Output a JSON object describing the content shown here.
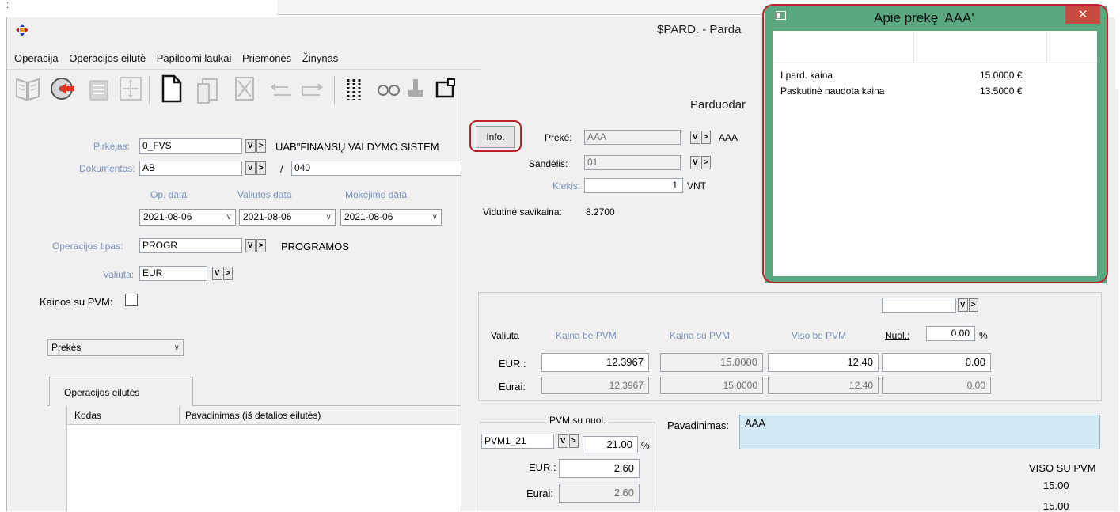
{
  "app": {
    "title": "$PARD. - Parda",
    "menu": [
      "Operacija",
      "Operacijos eilutė",
      "Papildomi laukai",
      "Priemonės",
      "Žinynas"
    ]
  },
  "form": {
    "pirkejas_label": "Pirkėjas:",
    "pirkejas_value": "0_FVS",
    "pirkejas_name": "UAB\"FINANSŲ VALDYMO SISTEM",
    "dokumentas_label": "Dokumentas:",
    "dokumentas_value": "AB",
    "dokumentas_sep": "/",
    "dokumentas_number": "040",
    "op_data_label": "Op. data",
    "valiutos_data_label": "Valiutos data",
    "mokejimo_data_label": "Mokėjimo data",
    "op_data": "2021-08-06",
    "valiutos_data": "2021-08-06",
    "mokejimo_data": "2021-08-06",
    "operacijos_tipas_label": "Operacijos tipas:",
    "operacijos_tipas_value": "PROGR",
    "operacijos_tipas_name": "PROGRAMOS",
    "valiuta_label": "Valiuta:",
    "valiuta_value": "EUR",
    "kainos_su_pvm_label": "Kainos su PVM:",
    "prekes_select": "Prekės",
    "tab_label": "Operacijos eilutės",
    "col_kodas": "Kodas",
    "col_pavadinimas": "Pavadinimas (iš detalios eilutės)"
  },
  "line_dialog": {
    "title": "Parduodar",
    "info_button": "Info.",
    "preke_label": "Prekė:",
    "preke_value": "AAA",
    "preke_name": "AAA",
    "sandelis_label": "Sandėlis:",
    "sandelis_value": "01",
    "kiekis_label": "Kiekis:",
    "kiekis_value": "1",
    "kiekis_unit": "VNT",
    "vid_savikaina_label": "Vidutinė savikaina:",
    "vid_savikaina_value": "8.2700",
    "col_valiuta": "Valiuta",
    "col_kaina_be_pvm": "Kaina be PVM",
    "col_kaina_su_pvm": "Kaina su PVM",
    "col_viso_be_pvm": "Viso be PVM",
    "nuol_label": "Nuol.:",
    "nuol_value": "0.00",
    "percent": "%",
    "row_eur_label": "EUR.:",
    "row_eur_kaina_be": "12.3967",
    "row_eur_kaina_su": "15.0000",
    "row_eur_viso_be": "12.40",
    "row_eur_nuol": "0.00",
    "row_eurai_label": "Eurai:",
    "row_eurai_kaina_be": "12.3967",
    "row_eurai_kaina_su": "15.0000",
    "row_eurai_viso_be": "12.40",
    "row_eurai_nuol": "0.00",
    "pvm_group_label": "PVM su nuol.",
    "pvm_code": "PVM1_21",
    "pvm_rate": "21.00",
    "pvm_eur_label": "EUR.:",
    "pvm_eur_value": "2.60",
    "pvm_eurai_label": "Eurai:",
    "pvm_eurai_value": "2.60",
    "pavadinimas_label": "Pavadinimas:",
    "pavadinimas_value": "AAA",
    "viso_su_pvm_label": "VISO SU PVM",
    "viso_su_pvm_1": "15.00",
    "viso_su_pvm_2": "15.00"
  },
  "popup": {
    "title": "Apie prekę 'AAA'",
    "rows": [
      {
        "label": "I pard. kaina",
        "value": "15.0000 €"
      },
      {
        "label": "Paskutinė naudota kaina",
        "value": "13.5000 €"
      }
    ]
  }
}
